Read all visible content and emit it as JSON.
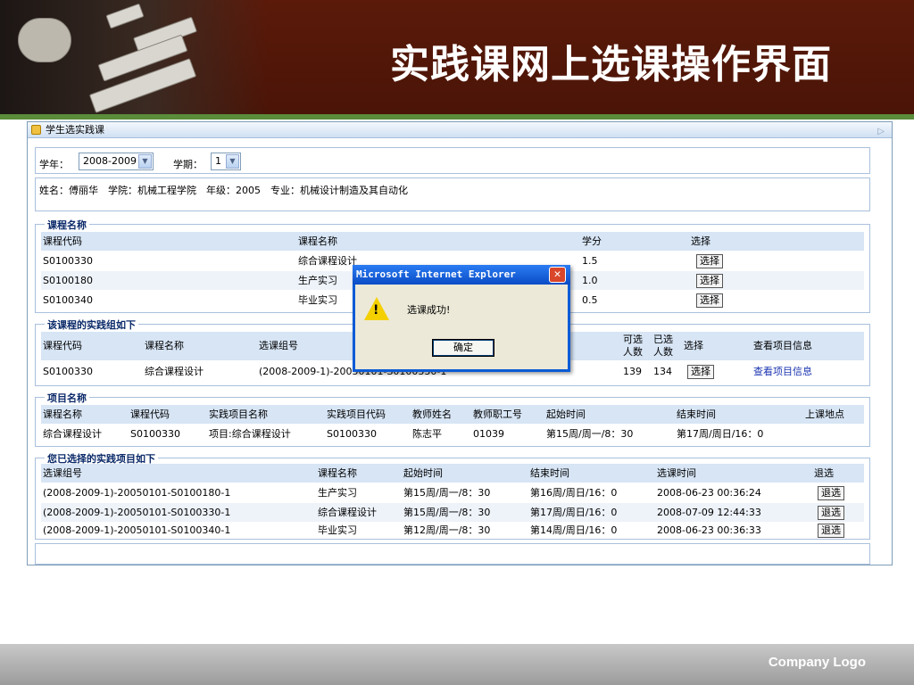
{
  "slide": {
    "title": "实践课网上选课操作界面",
    "footer_logo": "Company Logo"
  },
  "window": {
    "title": "学生选实践课"
  },
  "filters": {
    "year_label": "学年：",
    "year_value": "2008-2009",
    "term_label": "学期：",
    "term_value": "1"
  },
  "student_info": "姓名：傅丽华　学院：机械工程学院　年级：2005　专业：机械设计制造及其自动化",
  "courses": {
    "legend": "课程名称",
    "headers": [
      "课程代码",
      "课程名称",
      "学分",
      "选择"
    ],
    "rows": [
      {
        "code": "S0100330",
        "name": "综合课程设计",
        "credit": "1.5",
        "action": "选择"
      },
      {
        "code": "S0100180",
        "name": "生产实习",
        "credit": "1.0",
        "action": "选择"
      },
      {
        "code": "S0100340",
        "name": "毕业实习",
        "credit": "0.5",
        "action": "选择"
      }
    ]
  },
  "groups": {
    "legend": "该课程的实践组如下",
    "headers": [
      "课程代码",
      "课程名称",
      "选课组号",
      "可选人数",
      "已选人数",
      "选择",
      "查看项目信息"
    ],
    "rows": [
      {
        "code": "S0100330",
        "name": "综合课程设计",
        "group": "(2008-2009-1)-20050101-S0100330-1",
        "available": "139",
        "selected": "134",
        "action": "选择",
        "link": "查看项目信息"
      }
    ]
  },
  "projects": {
    "legend": "项目名称",
    "headers": [
      "课程名称",
      "课程代码",
      "实践项目名称",
      "实践项目代码",
      "教师姓名",
      "教师职工号",
      "起始时间",
      "结束时间",
      "上课地点"
    ],
    "rows": [
      {
        "course": "综合课程设计",
        "code": "S0100330",
        "project": "项目:综合课程设计",
        "project_code": "S0100330",
        "teacher": "陈志平",
        "teacher_id": "01039",
        "start": "第15周/周一/8：30",
        "end": "第17周/周日/16：0",
        "location": ""
      }
    ]
  },
  "chosen": {
    "legend": "您已选择的实践项目如下",
    "headers": [
      "选课组号",
      "课程名称",
      "起始时间",
      "结束时间",
      "选课时间",
      "退选"
    ],
    "rows": [
      {
        "group": "(2008-2009-1)-20050101-S0100180-1",
        "course": "生产实习",
        "start": "第15周/周一/8：30",
        "end": "第16周/周日/16：0",
        "time": "2008-06-23 00:36:24",
        "action": "退选"
      },
      {
        "group": "(2008-2009-1)-20050101-S0100330-1",
        "course": "综合课程设计",
        "start": "第15周/周一/8：30",
        "end": "第17周/周日/16：0",
        "time": "2008-07-09 12:44:33",
        "action": "退选"
      },
      {
        "group": "(2008-2009-1)-20050101-S0100340-1",
        "course": "毕业实习",
        "start": "第12周/周一/8：30",
        "end": "第14周/周日/16：0",
        "time": "2008-06-23 00:36:33",
        "action": "退选"
      }
    ]
  },
  "dialog": {
    "title": "Microsoft Internet Explorer",
    "close": "✕",
    "message": "选课成功!",
    "ok": "确定",
    "icon_mark": "!"
  },
  "colors": {
    "header_bg": "#4a1407",
    "accent_green": "#5a8c3a",
    "table_header": "#d7e5f5",
    "link": "#1a33b0",
    "dialog_title": "#0a4cc5"
  }
}
